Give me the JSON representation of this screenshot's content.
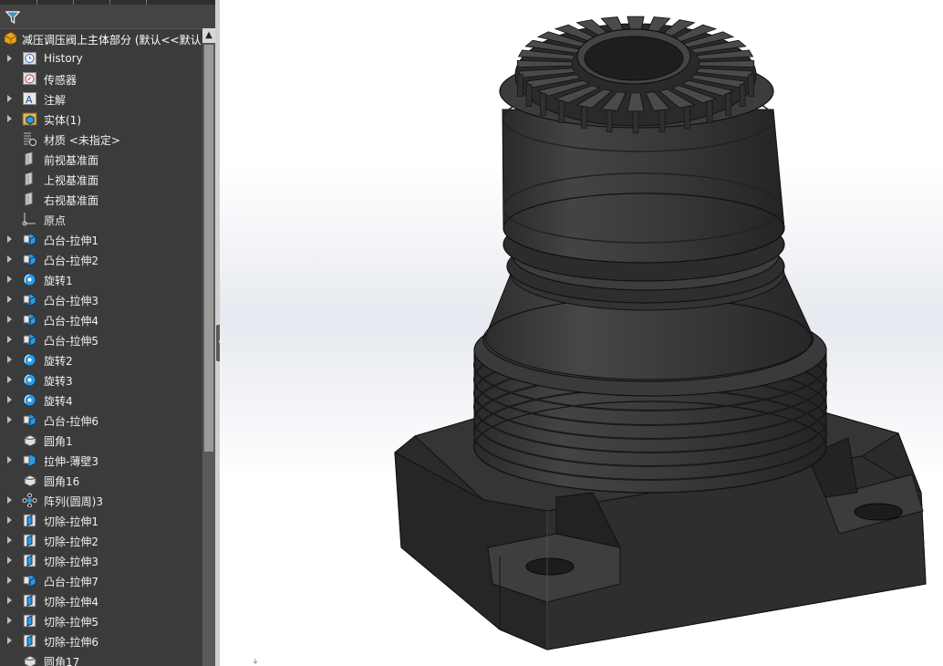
{
  "feature_tree": {
    "root_label": "减压调压阀上主体部分  (默认<<默认",
    "items": [
      {
        "label": "History",
        "icon": "history-icon",
        "expandable": true
      },
      {
        "label": "传感器",
        "icon": "sensor-icon",
        "expandable": false
      },
      {
        "label": "注解",
        "icon": "annotation-icon",
        "expandable": true
      },
      {
        "label": "实体(1)",
        "icon": "solid-bodies-icon",
        "expandable": true
      },
      {
        "label": "材质 <未指定>",
        "icon": "material-icon",
        "expandable": false
      },
      {
        "label": "前视基准面",
        "icon": "plane-icon",
        "expandable": false
      },
      {
        "label": "上视基准面",
        "icon": "plane-icon",
        "expandable": false
      },
      {
        "label": "右视基准面",
        "icon": "plane-icon",
        "expandable": false
      },
      {
        "label": "原点",
        "icon": "origin-icon",
        "expandable": false
      },
      {
        "label": "凸台-拉伸1",
        "icon": "boss-extrude-icon",
        "expandable": true
      },
      {
        "label": "凸台-拉伸2",
        "icon": "boss-extrude-icon",
        "expandable": true
      },
      {
        "label": "旋转1",
        "icon": "revolve-icon",
        "expandable": true
      },
      {
        "label": "凸台-拉伸3",
        "icon": "boss-extrude-icon",
        "expandable": true
      },
      {
        "label": "凸台-拉伸4",
        "icon": "boss-extrude-icon",
        "expandable": true
      },
      {
        "label": "凸台-拉伸5",
        "icon": "boss-extrude-icon",
        "expandable": true
      },
      {
        "label": "旋转2",
        "icon": "revolve-icon",
        "expandable": true
      },
      {
        "label": "旋转3",
        "icon": "revolve-icon",
        "expandable": true
      },
      {
        "label": "旋转4",
        "icon": "revolve-icon",
        "expandable": true
      },
      {
        "label": "凸台-拉伸6",
        "icon": "boss-extrude-icon",
        "expandable": true
      },
      {
        "label": "圆角1",
        "icon": "fillet-icon",
        "expandable": false
      },
      {
        "label": "拉伸-薄壁3",
        "icon": "thin-extrude-icon",
        "expandable": true
      },
      {
        "label": "圆角16",
        "icon": "fillet-icon",
        "expandable": false
      },
      {
        "label": "阵列(圆周)3",
        "icon": "circular-pattern-icon",
        "expandable": true
      },
      {
        "label": "切除-拉伸1",
        "icon": "cut-extrude-icon",
        "expandable": true
      },
      {
        "label": "切除-拉伸2",
        "icon": "cut-extrude-icon",
        "expandable": true
      },
      {
        "label": "切除-拉伸3",
        "icon": "cut-extrude-icon",
        "expandable": true
      },
      {
        "label": "凸台-拉伸7",
        "icon": "boss-extrude-icon",
        "expandable": true
      },
      {
        "label": "切除-拉伸4",
        "icon": "cut-extrude-icon",
        "expandable": true
      },
      {
        "label": "切除-拉伸5",
        "icon": "cut-extrude-icon",
        "expandable": true
      },
      {
        "label": "切除-拉伸6",
        "icon": "cut-extrude-icon",
        "expandable": true
      },
      {
        "label": "圆角17",
        "icon": "fillet-icon",
        "expandable": false
      }
    ]
  },
  "colors": {
    "panel_bg": "#3b3b3b",
    "feature_icon_blue": "#2e9be0",
    "model_dark": "#3a3a3a",
    "model_edge": "#111111"
  }
}
